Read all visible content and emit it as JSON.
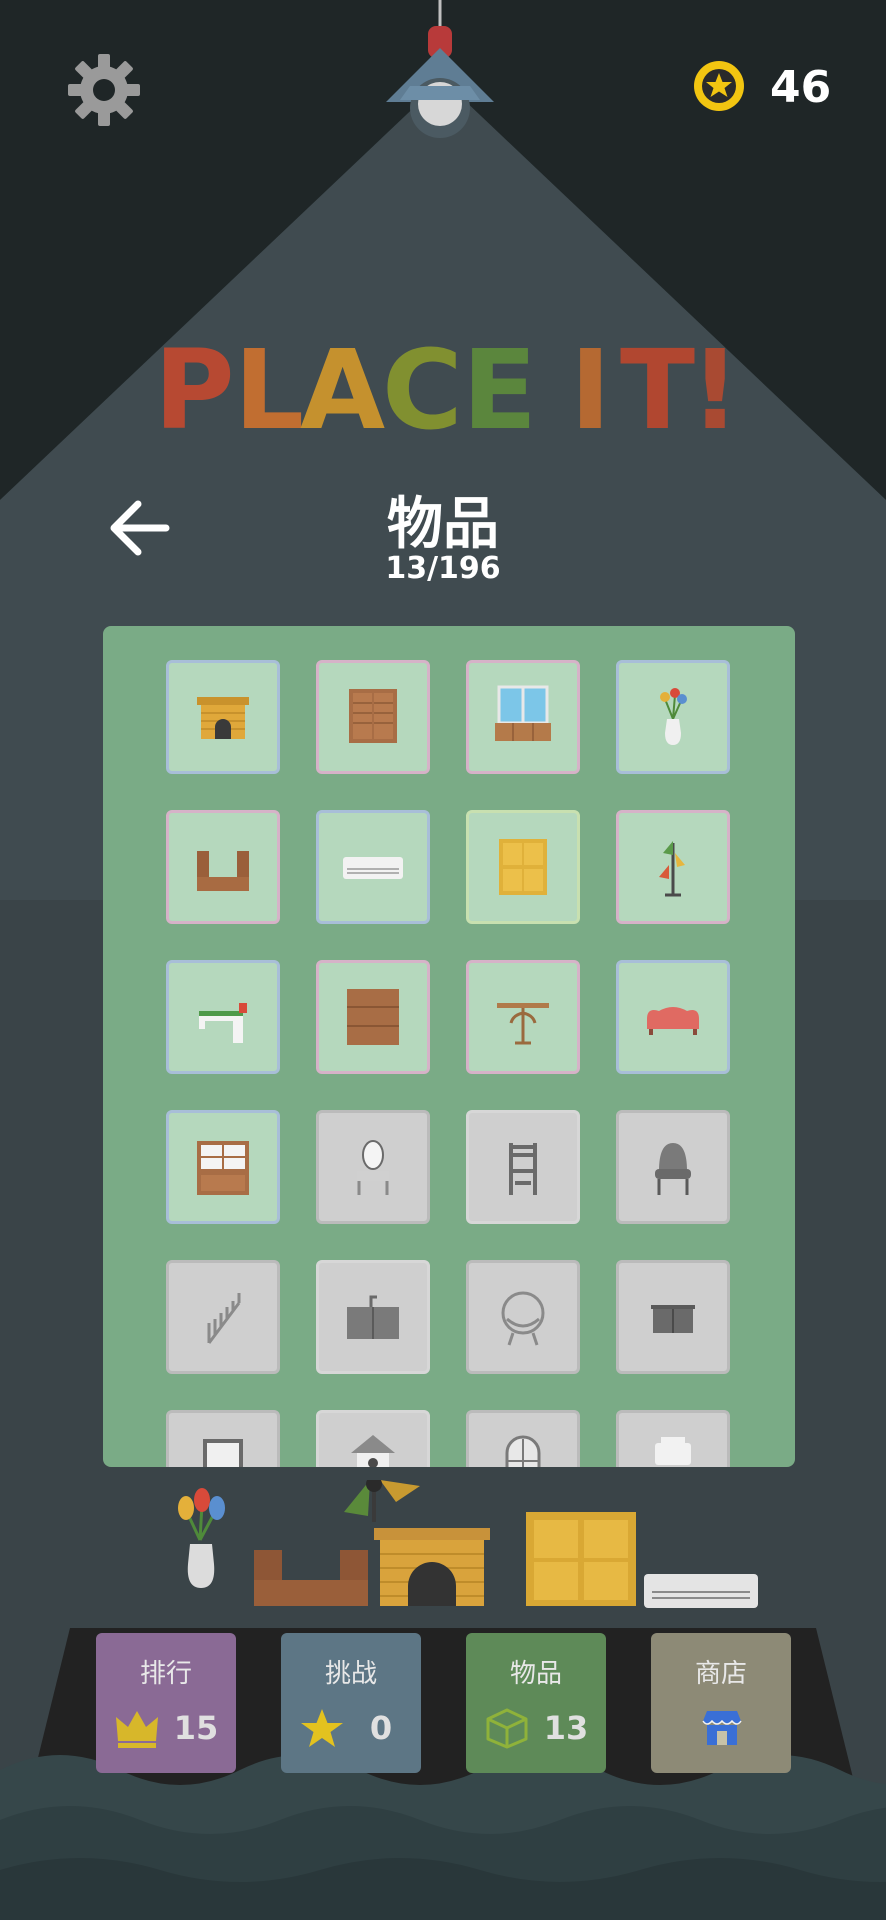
{
  "header": {
    "coins": "46",
    "settings_icon": "gear-icon",
    "coin_icon": "star-coin-icon"
  },
  "game_title": "PLACE IT!",
  "collection": {
    "title": "物品",
    "progress": "13/196",
    "unlocked_count": 13,
    "total_count": 196,
    "items": [
      {
        "name": "fireplace",
        "icon": "fireplace-icon",
        "unlocked": true
      },
      {
        "name": "wardrobe",
        "icon": "wardrobe-icon",
        "unlocked": true
      },
      {
        "name": "window-sideboard",
        "icon": "window-cabinet-icon",
        "unlocked": true
      },
      {
        "name": "flower-vase",
        "icon": "vase-icon",
        "unlocked": true
      },
      {
        "name": "corner-sofa",
        "icon": "corner-sofa-icon",
        "unlocked": true
      },
      {
        "name": "air-conditioner",
        "icon": "air-conditioner-icon",
        "unlocked": true
      },
      {
        "name": "drawer-chest",
        "icon": "drawer-chest-icon",
        "unlocked": true
      },
      {
        "name": "floor-lamp",
        "icon": "floor-lamp-icon",
        "unlocked": true
      },
      {
        "name": "sewing-machine",
        "icon": "sewing-machine-icon",
        "unlocked": true
      },
      {
        "name": "bookshelf",
        "icon": "bookshelf-icon",
        "unlocked": true
      },
      {
        "name": "bistro-table",
        "icon": "table-icon",
        "unlocked": true
      },
      {
        "name": "red-sofa",
        "icon": "sofa-icon",
        "unlocked": true
      },
      {
        "name": "window-cabinet",
        "icon": "hutch-icon",
        "unlocked": true
      },
      {
        "name": "vanity-mirror",
        "icon": "vanity-icon",
        "unlocked": false
      },
      {
        "name": "chair",
        "icon": "chair-icon",
        "unlocked": false
      },
      {
        "name": "armchair",
        "icon": "armchair-icon",
        "unlocked": false
      },
      {
        "name": "staircase",
        "icon": "stairs-icon",
        "unlocked": false
      },
      {
        "name": "sink-cabinet",
        "icon": "sink-cabinet-icon",
        "unlocked": false
      },
      {
        "name": "egg-chair",
        "icon": "egg-chair-icon",
        "unlocked": false
      },
      {
        "name": "side-cabinet",
        "icon": "cabinet-icon",
        "unlocked": false
      },
      {
        "name": "frame",
        "icon": "frame-icon",
        "unlocked": false
      },
      {
        "name": "birdhouse",
        "icon": "birdhouse-icon",
        "unlocked": false
      },
      {
        "name": "arched-window",
        "icon": "arch-window-icon",
        "unlocked": false
      },
      {
        "name": "toilet",
        "icon": "toilet-icon",
        "unlocked": false
      }
    ]
  },
  "bottom_menu": [
    {
      "label": "排行",
      "value": "15",
      "icon": "crown-icon",
      "color": "#8a6a95"
    },
    {
      "label": "挑战",
      "value": "0",
      "icon": "star-icon",
      "color": "#5d7685"
    },
    {
      "label": "物品",
      "value": "13",
      "icon": "box-icon",
      "color": "#5e8a58"
    },
    {
      "label": "商店",
      "value": "",
      "icon": "shop-icon",
      "color": "#8d8a76"
    }
  ]
}
